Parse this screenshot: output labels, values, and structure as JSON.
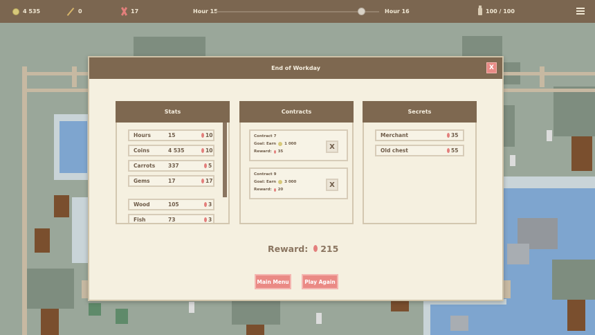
{
  "hud": {
    "coins": "4 535",
    "wands": "0",
    "bones": "17",
    "hour_start": "Hour 15",
    "hour_end": "Hour 16",
    "time_progress": 0.89,
    "capacity": "100 / 100"
  },
  "icons": [
    "coin-icon",
    "wand-icon",
    "bone-icon",
    "bottle-icon",
    "menu-icon",
    "gem-icon",
    "close-icon"
  ],
  "colors": {
    "accent": "#ea8a85",
    "header": "#7e6850",
    "panel_bg": "#f5f0e0",
    "gem": "#e37f7c",
    "coin": "#d7c97b"
  },
  "dialog": {
    "title": "End of Workday",
    "close_label": "X",
    "stats": {
      "title": "Stats",
      "rows": [
        {
          "label": "Hours",
          "value": "15",
          "reward": "10"
        },
        {
          "label": "Coins",
          "value": "4 535",
          "reward": "10"
        },
        {
          "label": "Carrots",
          "value": "337",
          "reward": "5"
        },
        {
          "label": "Gems",
          "value": "17",
          "reward": "17"
        },
        {
          "label": "Wood",
          "value": "105",
          "reward": "3"
        },
        {
          "label": "Fish",
          "value": "73",
          "reward": "3"
        }
      ]
    },
    "contracts": {
      "title": "Contracts",
      "items": [
        {
          "name": "Contract 7",
          "goal_label": "Goal: Earn",
          "goal_value": "1 000",
          "reward_label": "Reward:",
          "reward_value": "35",
          "cancel_label": "X"
        },
        {
          "name": "Contract 9",
          "goal_label": "Goal: Earn",
          "goal_value": "3 000",
          "reward_label": "Reward:",
          "reward_value": "20",
          "cancel_label": "X"
        }
      ]
    },
    "secrets": {
      "title": "Secrets",
      "rows": [
        {
          "label": "Merchant",
          "reward": "35"
        },
        {
          "label": "Old chest",
          "reward": "55"
        }
      ]
    },
    "reward_label": "Reward:",
    "reward_value": "215",
    "main_menu_label": "Main Menu",
    "play_again_label": "Play Again"
  }
}
